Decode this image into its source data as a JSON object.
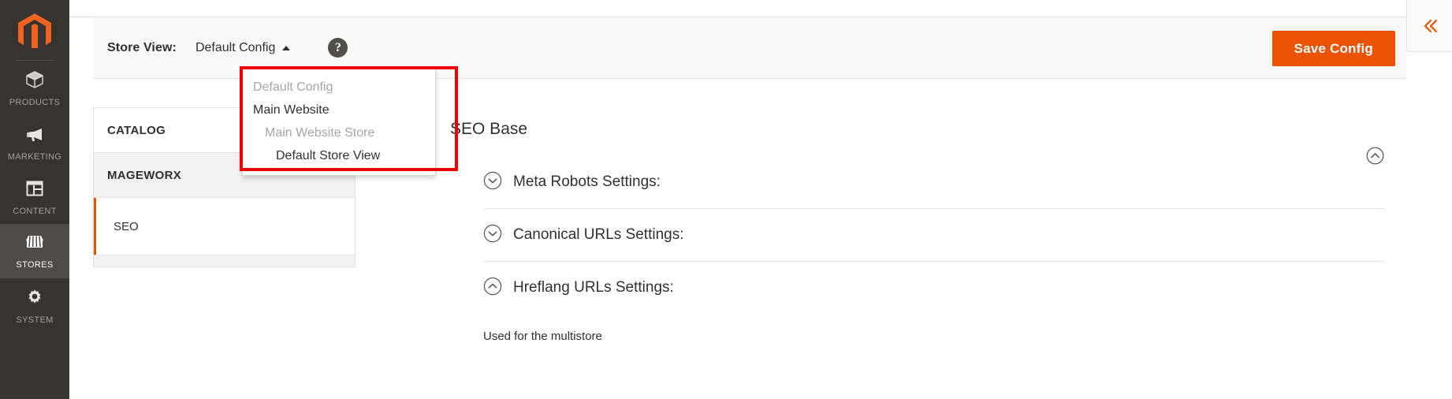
{
  "colors": {
    "brand_orange": "#eb5202",
    "sidebar_bg": "#373330",
    "highlight_red": "#ee0000",
    "text_dark": "#303030",
    "text_muted": "#a6a6a6"
  },
  "sidebar": {
    "logo_name": "magento-logo",
    "items": [
      {
        "label": "PRODUCTS",
        "icon": "box-icon",
        "active": false
      },
      {
        "label": "MARKETING",
        "icon": "megaphone-icon",
        "active": false
      },
      {
        "label": "CONTENT",
        "icon": "layout-icon",
        "active": false
      },
      {
        "label": "STORES",
        "icon": "storefront-icon",
        "active": true
      },
      {
        "label": "SYSTEM",
        "icon": "gear-icon",
        "active": false
      }
    ]
  },
  "header": {
    "store_view_label": "Store View:",
    "store_view_value": "Default Config",
    "store_view_caret": "caret-up-icon",
    "help_icon": "question-mark-icon",
    "help_glyph": "?",
    "save_button": "Save Config",
    "collapse_icon": "double-chevron-left-icon",
    "collapse_glyph": "«"
  },
  "store_view_dropdown": {
    "open": true,
    "options": [
      {
        "label": "Default Config",
        "level": 0,
        "selectable": false
      },
      {
        "label": "Main Website",
        "level": 1,
        "selectable": true
      },
      {
        "label": "Main Website Store",
        "level": 2,
        "selectable": false
      },
      {
        "label": "Default Store View",
        "level": 3,
        "selectable": true
      }
    ]
  },
  "config_nav": {
    "sections": [
      {
        "title": "CATALOG",
        "chevron": "chevron-down-icon",
        "expanded": false,
        "shade": "white"
      },
      {
        "title": "MAGEWORX",
        "chevron": "chevron-up-icon",
        "expanded": true,
        "shade": "grey"
      }
    ],
    "items": [
      {
        "label": "SEO",
        "active": true
      }
    ]
  },
  "content": {
    "title": "SEO Base",
    "section_toggle_icon": "circle-chevron-up-icon",
    "fieldsets": [
      {
        "label": "Meta Robots Settings:",
        "icon": "circle-chevron-down-icon",
        "expanded": false
      },
      {
        "label": "Canonical URLs Settings:",
        "icon": "circle-chevron-down-icon",
        "expanded": false
      },
      {
        "label": "Hreflang URLs Settings:",
        "icon": "circle-chevron-up-icon",
        "expanded": true
      }
    ],
    "note": "Used for the multistore"
  }
}
